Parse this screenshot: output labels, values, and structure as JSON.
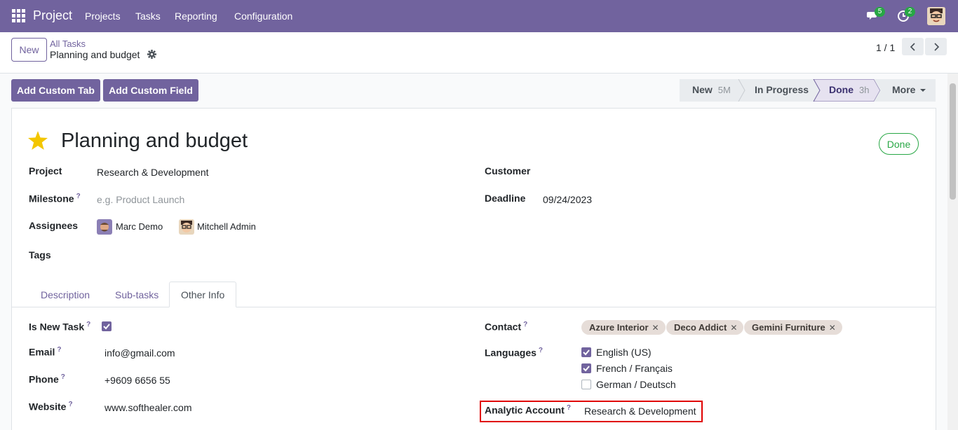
{
  "navbar": {
    "brand": "Project",
    "menu": [
      "Projects",
      "Tasks",
      "Reporting",
      "Configuration"
    ],
    "messages_count": "5",
    "activities_count": "2",
    "accent": "#71639e"
  },
  "control_panel": {
    "new_label": "New",
    "breadcrumb_parent": "All Tasks",
    "breadcrumb_current": "Planning and budget",
    "pager": "1 / 1"
  },
  "actions": {
    "add_custom_tab": "Add Custom Tab",
    "add_custom_field": "Add Custom Field"
  },
  "statusbar": {
    "steps": [
      {
        "label": "New",
        "sub": "5M",
        "active": false
      },
      {
        "label": "In Progress",
        "sub": "",
        "active": false
      },
      {
        "label": "Done",
        "sub": "3h",
        "active": true
      }
    ],
    "more_label": "More"
  },
  "task": {
    "title": "Planning and budget",
    "state_badge": "Done",
    "project_label": "Project",
    "project_value": "Research & Development",
    "milestone_label": "Milestone",
    "milestone_placeholder": "e.g. Product Launch",
    "assignees_label": "Assignees",
    "assignees": [
      "Marc Demo",
      "Mitchell Admin"
    ],
    "tags_label": "Tags",
    "customer_label": "Customer",
    "deadline_label": "Deadline",
    "deadline_value": "09/24/2023"
  },
  "tabs": [
    "Description",
    "Sub-tasks",
    "Other Info"
  ],
  "other_info": {
    "is_new_task_label": "Is New Task",
    "is_new_task_checked": true,
    "email_label": "Email",
    "email_value": "info@gmail.com",
    "phone_label": "Phone",
    "phone_value": "+9609 6656 55",
    "website_label": "Website",
    "website_value": "www.softhealer.com",
    "contact_label": "Contact",
    "contacts": [
      "Azure Interior",
      "Deco Addict",
      "Gemini Furniture"
    ],
    "languages_label": "Languages",
    "languages": [
      {
        "label": "English (US)",
        "checked": true
      },
      {
        "label": "French / Français",
        "checked": true
      },
      {
        "label": "German / Deutsch",
        "checked": false
      }
    ],
    "analytic_account_label": "Analytic Account",
    "analytic_account_value": "Research & Development"
  },
  "help_mark": "?"
}
